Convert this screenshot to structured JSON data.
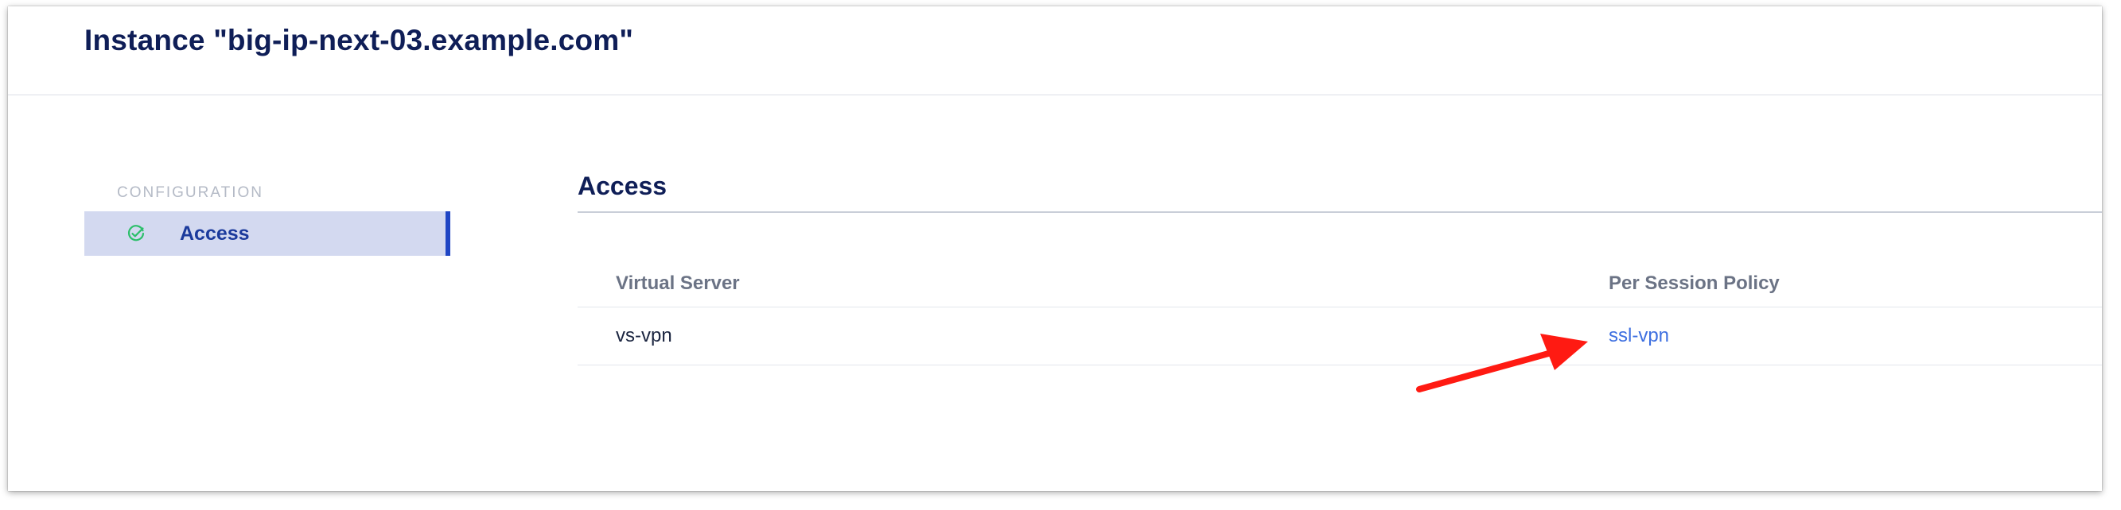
{
  "header": {
    "title": "Instance \"big-ip-next-03.example.com\""
  },
  "sidebar": {
    "heading": "CONFIGURATION",
    "items": [
      {
        "label": "Access",
        "icon": "check-circle-icon",
        "selected": true
      }
    ]
  },
  "main": {
    "section_title": "Access",
    "table": {
      "columns": [
        "Virtual Server",
        "Per Session Policy"
      ],
      "rows": [
        {
          "virtual_server": "vs-vpn",
          "policy": "ssl-vpn"
        }
      ]
    }
  },
  "colors": {
    "accent": "#1f45c4",
    "selected_bg": "#d3d9f0",
    "link": "#3d6fe0",
    "success": "#2bbf6a",
    "annotation": "#ff1a12"
  }
}
